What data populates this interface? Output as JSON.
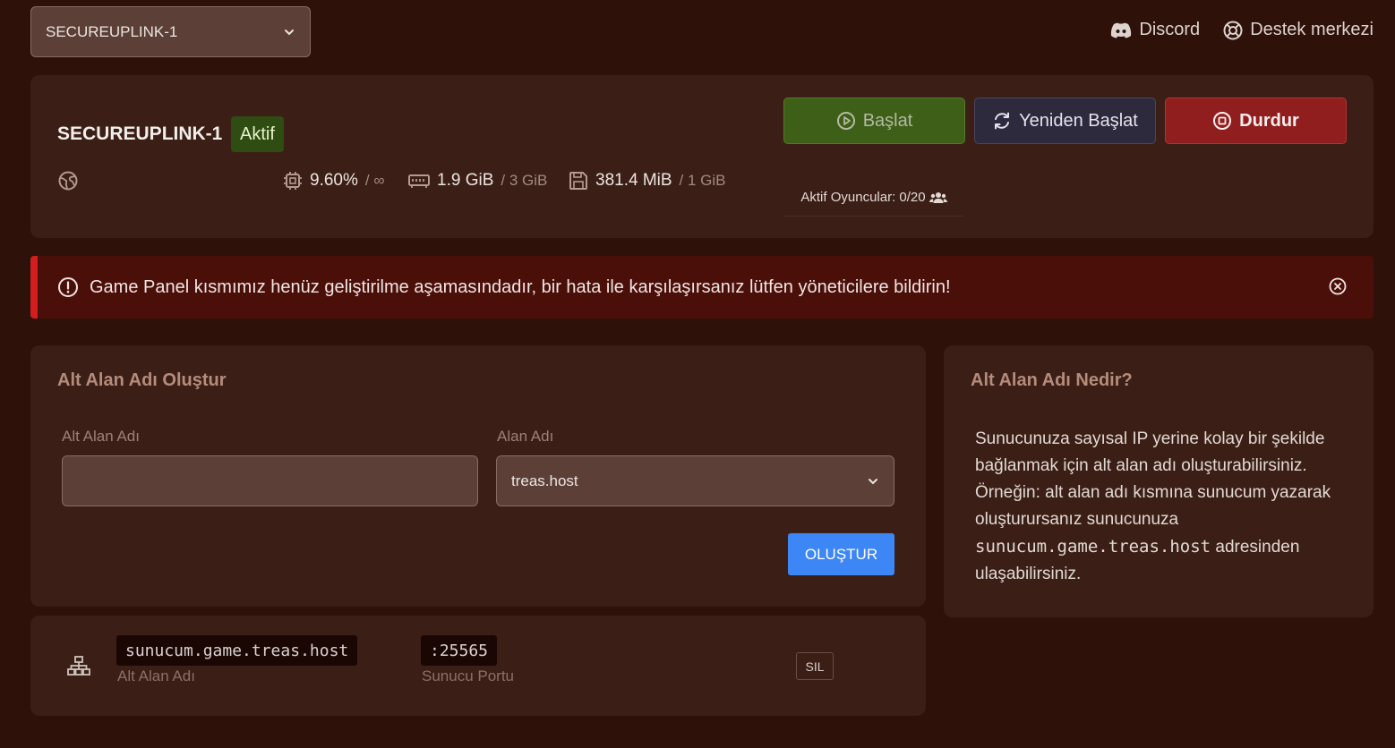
{
  "server_selector": {
    "selected": "SECUREUPLINK-1"
  },
  "top_links": {
    "discord": "Discord",
    "support": "Destek merkezi"
  },
  "server": {
    "name": "SECUREUPLINK-1",
    "status": "Aktif",
    "cpu": "9.60%",
    "cpu_limit": "/ ∞",
    "memory": "1.9 GiB",
    "memory_limit": "/ 3 GiB",
    "disk": "381.4 MiB",
    "disk_limit": "/ 1 GiB",
    "players": "Aktif Oyuncular: 0/20"
  },
  "power_buttons": {
    "start": "Başlat",
    "restart": "Yeniden Başlat",
    "stop": "Durdur"
  },
  "alert": {
    "message": "Game Panel kısmımız henüz geliştirilme aşamasındadır, bir hata ile karşılaşırsanız lütfen yöneticilere bildirin!"
  },
  "create_subdomain": {
    "title": "Alt Alan Adı Oluştur",
    "subdomain_label": "Alt Alan Adı",
    "subdomain_value": "",
    "domain_label": "Alan Adı",
    "domain_selected": "treas.host",
    "submit": "OLUŞTUR"
  },
  "info": {
    "title": "Alt Alan Adı Nedir?",
    "text_before": "Sunucunuza sayısal IP yerine kolay bir şekilde bağlanmak için alt alan adı oluşturabilirsiniz. Örneğin: alt alan adı kısmına sunucum yazarak oluşturursanız sunucunuza ",
    "example": "sunucum.game.treas.host",
    "text_after": " adresinden ulaşabilirsiniz."
  },
  "subdomain_entry": {
    "hostname": "sunucum.game.treas.host",
    "hostname_label": "Alt Alan Adı",
    "port": ":25565",
    "port_label": "Sunucu Portu",
    "delete": "SIL"
  }
}
